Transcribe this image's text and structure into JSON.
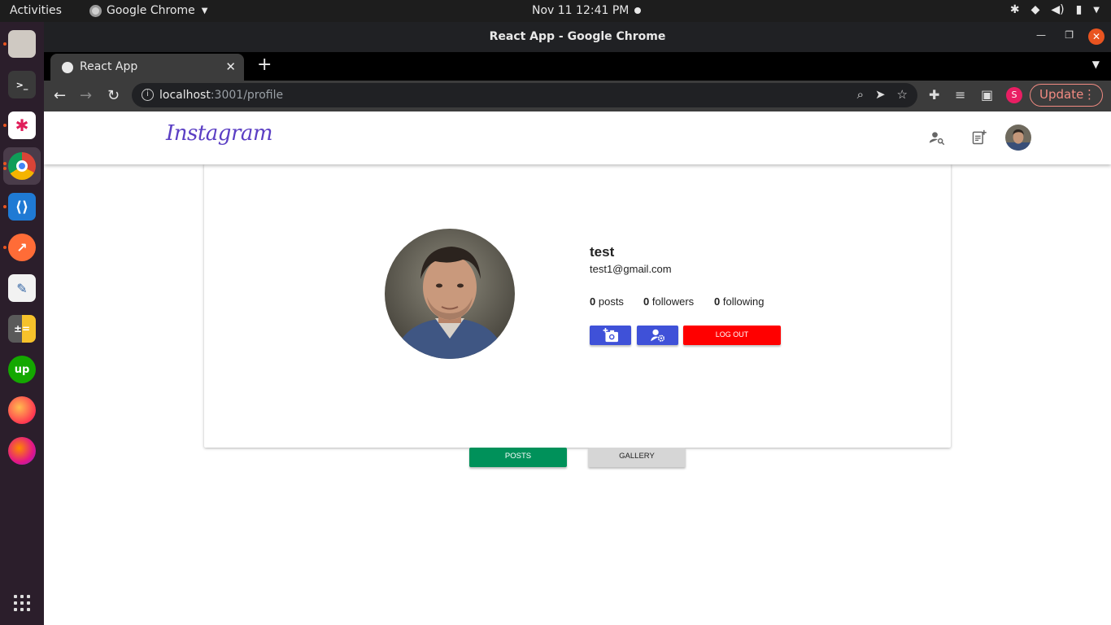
{
  "system": {
    "activities": "Activities",
    "app_name": "Google Chrome",
    "clock": "Nov 11  12:41 PM"
  },
  "window": {
    "title": "React App - Google Chrome"
  },
  "tab": {
    "label": "React App"
  },
  "omnibox": {
    "host": "localhost",
    "path": ":3001/profile"
  },
  "toolbar": {
    "profile_initial": "S",
    "update_label": "Update"
  },
  "app": {
    "logo_text": "Instagram",
    "brand_color": "#5b3fc4"
  },
  "profile": {
    "username": "test",
    "email": "test1@gmail.com",
    "posts_count": "0",
    "posts_label": "posts",
    "followers_count": "0",
    "followers_label": "followers",
    "following_count": "0",
    "following_label": "following",
    "logout_label": "LOG OUT"
  },
  "tabs": {
    "posts_label": "POSTS",
    "gallery_label": "GALLERY"
  }
}
